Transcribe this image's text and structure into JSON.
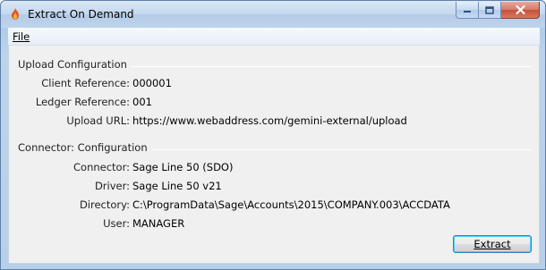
{
  "window": {
    "title": "Extract On Demand",
    "icons": {
      "app": "database-flame-icon",
      "minimize": "minimize-icon",
      "maximize": "maximize-icon",
      "close": "close-icon"
    }
  },
  "menu": {
    "file_label": "File"
  },
  "upload_configuration": {
    "heading": "Upload Configuration",
    "rows": [
      {
        "label": "Client Reference:",
        "value": "000001"
      },
      {
        "label": "Ledger Reference:",
        "value": "001"
      },
      {
        "label": "Upload URL:",
        "value": "https://www.webaddress.com/gemini-external/upload"
      }
    ]
  },
  "connector_configuration": {
    "heading": "Connector: Configuration",
    "rows": [
      {
        "label": "Connector:",
        "value": "Sage Line 50 (SDO)"
      },
      {
        "label": "Driver:",
        "value": "Sage Line 50 v21"
      },
      {
        "label": "Directory:",
        "value": "C:\\ProgramData\\Sage\\Accounts\\2015\\COMPANY.003\\ACCDATA"
      },
      {
        "label": "User:",
        "value": "MANAGER"
      }
    ]
  },
  "actions": {
    "extract_label": "Extract"
  },
  "colors": {
    "titlebar": "#c3d7ee",
    "client_bg": "#f0f0f0",
    "close_button": "#c4513b",
    "button_focus": "#3c7fb1"
  }
}
